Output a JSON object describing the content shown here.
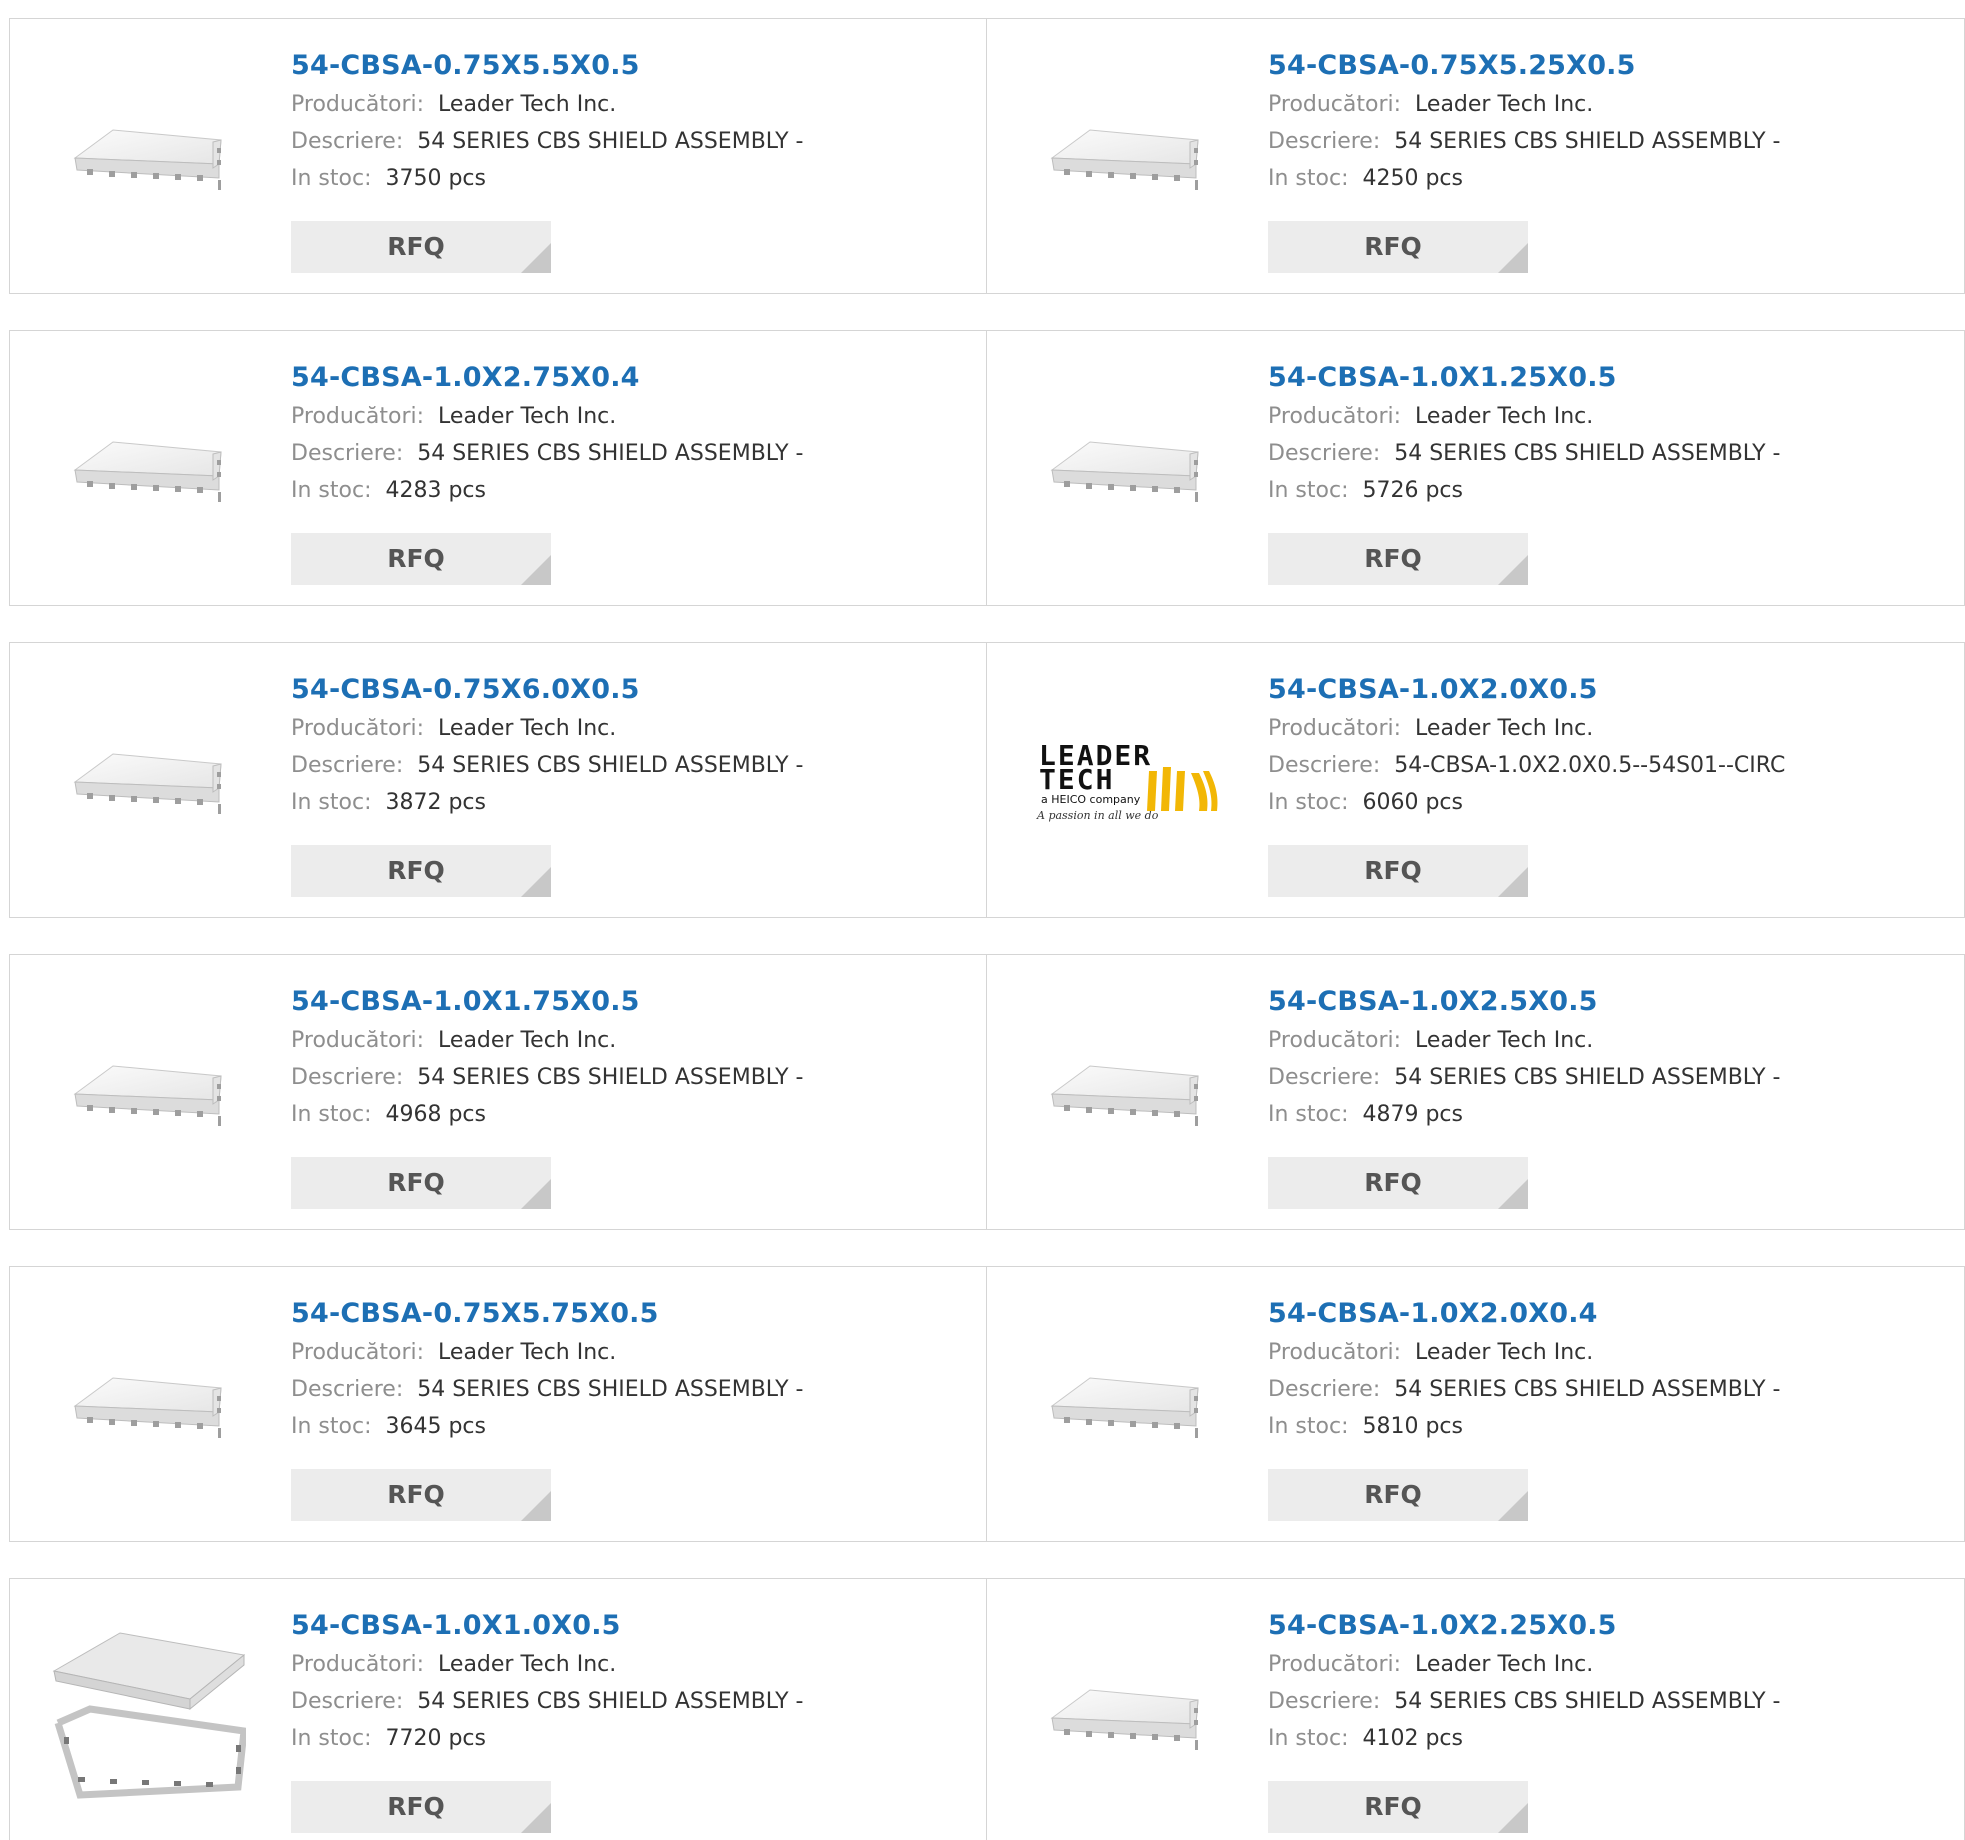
{
  "labels": {
    "manufacturer": "Producători:",
    "description": "Descriere:",
    "stock": "In stoc:",
    "rfq": "RFQ"
  },
  "logo": {
    "line1": "LEADER",
    "line2": "TECH",
    "line3": "a HEICO company",
    "line4": "A passion in all we do"
  },
  "products": [
    {
      "part": "54-CBSA-0.75X5.5X0.5",
      "manufacturer": "Leader Tech Inc.",
      "description": "54 SERIES CBS SHIELD ASSEMBLY -",
      "stock": "3750 pcs",
      "image": "shield"
    },
    {
      "part": "54-CBSA-0.75X5.25X0.5",
      "manufacturer": "Leader Tech Inc.",
      "description": "54 SERIES CBS SHIELD ASSEMBLY -",
      "stock": "4250 pcs",
      "image": "shield"
    },
    {
      "part": "54-CBSA-1.0X2.75X0.4",
      "manufacturer": "Leader Tech Inc.",
      "description": "54 SERIES CBS SHIELD ASSEMBLY -",
      "stock": "4283 pcs",
      "image": "shield"
    },
    {
      "part": "54-CBSA-1.0X1.25X0.5",
      "manufacturer": "Leader Tech Inc.",
      "description": "54 SERIES CBS SHIELD ASSEMBLY -",
      "stock": "5726 pcs",
      "image": "shield"
    },
    {
      "part": "54-CBSA-0.75X6.0X0.5",
      "manufacturer": "Leader Tech Inc.",
      "description": "54 SERIES CBS SHIELD ASSEMBLY -",
      "stock": "3872 pcs",
      "image": "shield"
    },
    {
      "part": "54-CBSA-1.0X2.0X0.5",
      "manufacturer": "Leader Tech Inc.",
      "description": "54-CBSA-1.0X2.0X0.5--54S01--CIRC",
      "stock": "6060 pcs",
      "image": "logo"
    },
    {
      "part": "54-CBSA-1.0X1.75X0.5",
      "manufacturer": "Leader Tech Inc.",
      "description": "54 SERIES CBS SHIELD ASSEMBLY -",
      "stock": "4968 pcs",
      "image": "shield"
    },
    {
      "part": "54-CBSA-1.0X2.5X0.5",
      "manufacturer": "Leader Tech Inc.",
      "description": "54 SERIES CBS SHIELD ASSEMBLY -",
      "stock": "4879 pcs",
      "image": "shield"
    },
    {
      "part": "54-CBSA-0.75X5.75X0.5",
      "manufacturer": "Leader Tech Inc.",
      "description": "54 SERIES CBS SHIELD ASSEMBLY -",
      "stock": "3645 pcs",
      "image": "shield"
    },
    {
      "part": "54-CBSA-1.0X2.0X0.4",
      "manufacturer": "Leader Tech Inc.",
      "description": "54 SERIES CBS SHIELD ASSEMBLY -",
      "stock": "5810 pcs",
      "image": "shield"
    },
    {
      "part": "54-CBSA-1.0X1.0X0.5",
      "manufacturer": "Leader Tech Inc.",
      "description": "54 SERIES CBS SHIELD ASSEMBLY -",
      "stock": "7720 pcs",
      "image": "shield-open"
    },
    {
      "part": "54-CBSA-1.0X2.25X0.5",
      "manufacturer": "Leader Tech Inc.",
      "description": "54 SERIES CBS SHIELD ASSEMBLY -",
      "stock": "4102 pcs",
      "image": "shield"
    }
  ]
}
